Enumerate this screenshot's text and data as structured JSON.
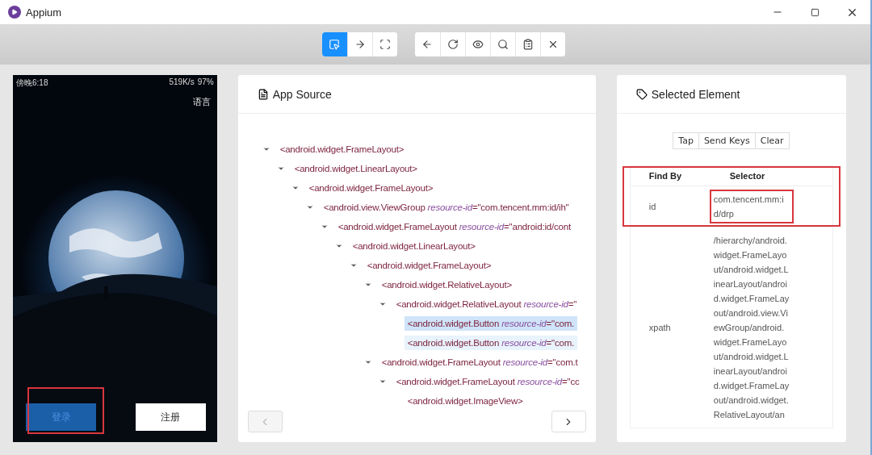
{
  "window": {
    "title": "Appium"
  },
  "toolbar": {
    "modes": [
      {
        "kind": "select",
        "selected": true
      },
      {
        "kind": "swipe",
        "selected": false
      },
      {
        "kind": "tap",
        "selected": false
      }
    ],
    "actions": [
      {
        "kind": "back"
      },
      {
        "kind": "refresh"
      },
      {
        "kind": "show"
      },
      {
        "kind": "search"
      },
      {
        "kind": "copy"
      },
      {
        "kind": "quit"
      }
    ]
  },
  "device": {
    "clock": "傍晚6:18",
    "speed": "519K/s",
    "battery": "97%",
    "language": "语言",
    "buttons": [
      {
        "label": "登录",
        "kind": "primary",
        "highlighted": true
      },
      {
        "label": "注册",
        "kind": "secondary",
        "highlighted": false
      }
    ]
  },
  "app_source": {
    "title": "App Source",
    "prev_disabled": true,
    "next_disabled": false,
    "tree": [
      {
        "tag": "<android.widget.FrameLayout>",
        "expanded": true,
        "selected": false,
        "hovered": false,
        "children": [
          {
            "tag": "<android.widget.LinearLayout>",
            "expanded": true,
            "selected": false,
            "hovered": false,
            "children": [
              {
                "tag": "<android.widget.FrameLayout>",
                "expanded": true,
                "selected": false,
                "hovered": false,
                "children": [
                  {
                    "tag": "<android.view.ViewGroup",
                    "attr": "resource-id",
                    "value": "=\"com.tencent.mm:id/ih\"",
                    "expanded": true,
                    "selected": false,
                    "hovered": false,
                    "children": [
                      {
                        "tag": "<android.widget.FrameLayout",
                        "attr": "resource-id",
                        "value": "=\"android:id/cont",
                        "expanded": true,
                        "selected": false,
                        "hovered": false,
                        "children": [
                          {
                            "tag": "<android.widget.LinearLayout>",
                            "expanded": true,
                            "selected": false,
                            "hovered": false,
                            "children": [
                              {
                                "tag": "<android.widget.FrameLayout>",
                                "expanded": true,
                                "selected": false,
                                "hovered": false,
                                "children": [
                                  {
                                    "tag": "<android.widget.RelativeLayout>",
                                    "expanded": true,
                                    "selected": false,
                                    "hovered": false,
                                    "children": [
                                      {
                                        "tag": "<android.widget.RelativeLayout",
                                        "attr": "resource-id",
                                        "value": "=\"",
                                        "expanded": true,
                                        "selected": false,
                                        "hovered": false,
                                        "children": [
                                          {
                                            "tag": "<android.widget.Button",
                                            "attr": "resource-id",
                                            "value": "=\"com.",
                                            "selected": true,
                                            "hovered": false
                                          },
                                          {
                                            "tag": "<android.widget.Button",
                                            "attr": "resource-id",
                                            "value": "=\"com.",
                                            "selected": false,
                                            "hovered": true
                                          }
                                        ]
                                      }
                                    ]
                                  },
                                  {
                                    "tag": "<android.widget.FrameLayout",
                                    "attr": "resource-id",
                                    "value": "=\"com.t",
                                    "expanded": true,
                                    "selected": false,
                                    "hovered": false,
                                    "children": [
                                      {
                                        "tag": "<android.widget.FrameLayout",
                                        "attr": "resource-id",
                                        "value": "=\"cc",
                                        "expanded": true,
                                        "selected": false,
                                        "hovered": false,
                                        "children": [
                                          {
                                            "tag": "<android.widget.ImageView>",
                                            "selected": false,
                                            "hovered": false
                                          }
                                        ]
                                      }
                                    ]
                                  }
                                ]
                              }
                            ]
                          }
                        ]
                      }
                    ]
                  }
                ]
              }
            ]
          }
        ]
      }
    ]
  },
  "selected_element": {
    "title": "Selected Element",
    "actions": [
      "Tap",
      "Send Keys",
      "Clear"
    ],
    "table": {
      "columns": [
        "Find By",
        "Selector"
      ],
      "highlighted": true,
      "rows": [
        {
          "find_by": "id",
          "selector": "com.tencent.mm:id/drp",
          "highlighted": true
        },
        {
          "find_by": "xpath",
          "selector": "/hierarchy/android.widget.FrameLayout/android.widget.LinearLayout/android.widget.FrameLayout/android.view.ViewGroup/android.widget.FrameLayout/android.widget.LinearLayout/android.widget.FrameLayout/android.widget.RelativeLayout/an",
          "highlighted": false
        }
      ]
    }
  }
}
